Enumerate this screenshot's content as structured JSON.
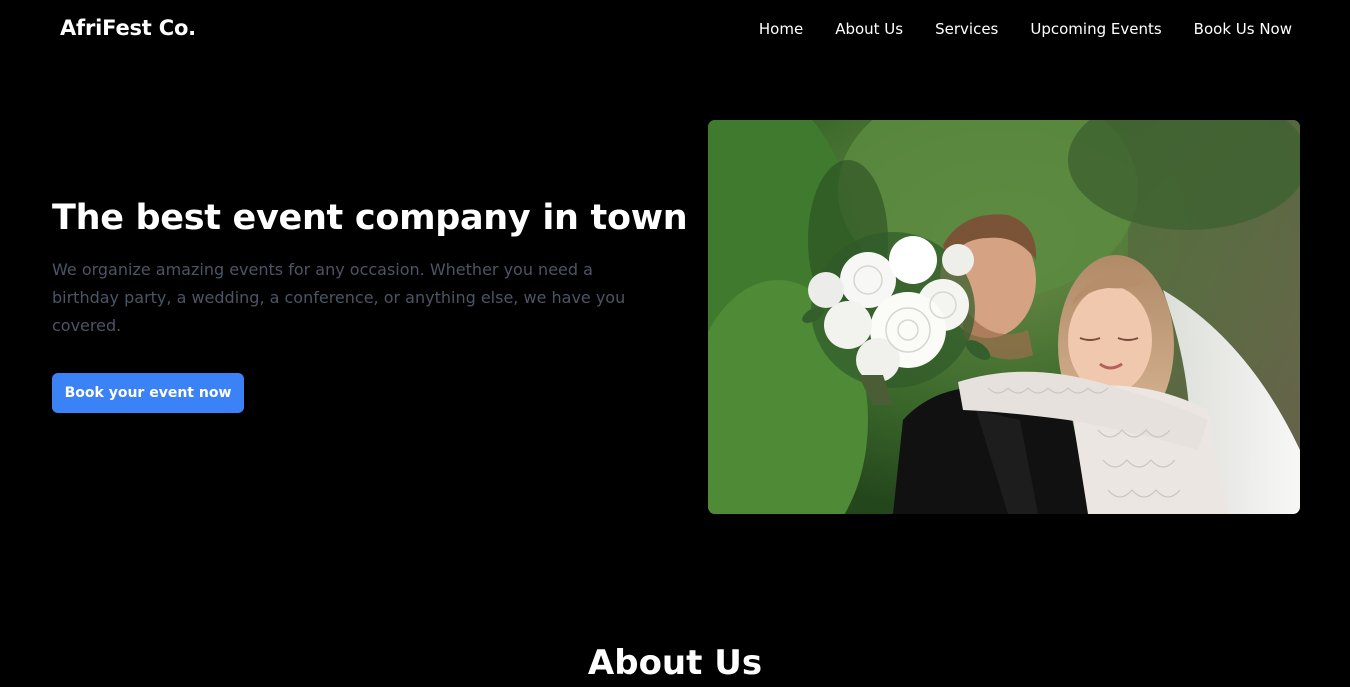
{
  "header": {
    "brand": "AfriFest Co.",
    "nav": [
      {
        "label": "Home"
      },
      {
        "label": "About Us"
      },
      {
        "label": "Services"
      },
      {
        "label": "Upcoming Events"
      },
      {
        "label": "Book Us Now"
      }
    ]
  },
  "hero": {
    "title": "The best event company in town",
    "description": "We organize amazing events for any occasion. Whether you need a birthday party, a wedding, a conference, or anything else, we have you covered.",
    "cta_label": "Book your event now",
    "image_alt": "Wedding couple with bridal bouquet in a garden"
  },
  "about": {
    "title": "About Us"
  },
  "colors": {
    "background": "#000000",
    "text": "#ffffff",
    "muted_text": "#4b5565",
    "accent": "#3b82f6"
  }
}
